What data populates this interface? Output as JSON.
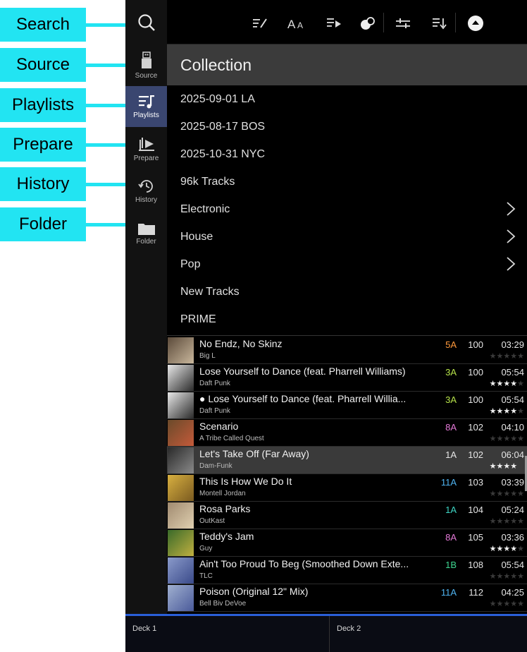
{
  "callouts": [
    {
      "key": "search",
      "label": "Search"
    },
    {
      "key": "source",
      "label": "Source"
    },
    {
      "key": "playlists",
      "label": "Playlists"
    },
    {
      "key": "prepare",
      "label": "Prepare"
    },
    {
      "key": "history",
      "label": "History"
    },
    {
      "key": "folder",
      "label": "Folder"
    }
  ],
  "rail": {
    "source": "Source",
    "playlists": "Playlists",
    "prepare": "Prepare",
    "history": "History",
    "folder": "Folder"
  },
  "toolbar_icons": [
    "edit-list-icon",
    "font-size-icon",
    "playlist-play-icon",
    "color-toggle-icon",
    "filter-icon",
    "sort-icon",
    "eject-icon"
  ],
  "collection": {
    "title": "Collection",
    "items": [
      {
        "label": "2025-09-01 LA",
        "has_children": false
      },
      {
        "label": "2025-08-17 BOS",
        "has_children": false
      },
      {
        "label": "2025-10-31 NYC",
        "has_children": false
      },
      {
        "label": "96k Tracks",
        "has_children": false
      },
      {
        "label": "Electronic",
        "has_children": true
      },
      {
        "label": "House",
        "has_children": true
      },
      {
        "label": "Pop",
        "has_children": true
      },
      {
        "label": "New Tracks",
        "has_children": false
      },
      {
        "label": "PRIME",
        "has_children": false
      }
    ]
  },
  "tracks": [
    {
      "title": "No Endz, No Skinz",
      "artist": "Big L",
      "key": "5A",
      "key_color": "#ff9a3c",
      "bpm": "100",
      "time": "03:29",
      "stars": 0,
      "selected": false
    },
    {
      "title": "Lose Yourself to Dance (feat. Pharrell Williams)",
      "artist": "Daft Punk",
      "key": "3A",
      "key_color": "#b6e24a",
      "bpm": "100",
      "time": "05:54",
      "stars": 4,
      "selected": false
    },
    {
      "title": "Lose Yourself to Dance (feat. Pharrell Willia...",
      "artist": "Daft Punk",
      "key": "3A",
      "key_color": "#b6e24a",
      "bpm": "100",
      "time": "05:54",
      "stars": 4,
      "selected": false,
      "streaming": true
    },
    {
      "title": "Scenario",
      "artist": "A Tribe Called Quest",
      "key": "8A",
      "key_color": "#e57ad8",
      "bpm": "102",
      "time": "04:10",
      "stars": 0,
      "selected": false
    },
    {
      "title": "Let's Take Off (Far Away)",
      "artist": "Dam-Funk",
      "key": "1A",
      "key_color": "#e6e6e6",
      "bpm": "102",
      "time": "06:04",
      "stars": 4,
      "selected": true
    },
    {
      "title": "This Is How We Do It",
      "artist": "Montell Jordan",
      "key": "11A",
      "key_color": "#4fb3f0",
      "bpm": "103",
      "time": "03:39",
      "stars": 0,
      "selected": false
    },
    {
      "title": "Rosa Parks",
      "artist": "OutKast",
      "key": "1A",
      "key_color": "#3ed6c4",
      "bpm": "104",
      "time": "05:24",
      "stars": 0,
      "selected": false
    },
    {
      "title": "Teddy's Jam",
      "artist": "Guy",
      "key": "8A",
      "key_color": "#e57ad8",
      "bpm": "105",
      "time": "03:36",
      "stars": 4,
      "selected": false
    },
    {
      "title": "Ain't Too Proud To Beg (Smoothed Down Exte...",
      "artist": "TLC",
      "key": "1B",
      "key_color": "#3ed690",
      "bpm": "108",
      "time": "05:54",
      "stars": 0,
      "selected": false
    },
    {
      "title": "Poison (Original 12\" Mix)",
      "artist": "Bell Biv DeVoe",
      "key": "11A",
      "key_color": "#4fb3f0",
      "bpm": "112",
      "time": "04:25",
      "stars": 0,
      "selected": false
    }
  ],
  "decks": {
    "deck1": "Deck 1",
    "deck2": "Deck 2"
  }
}
